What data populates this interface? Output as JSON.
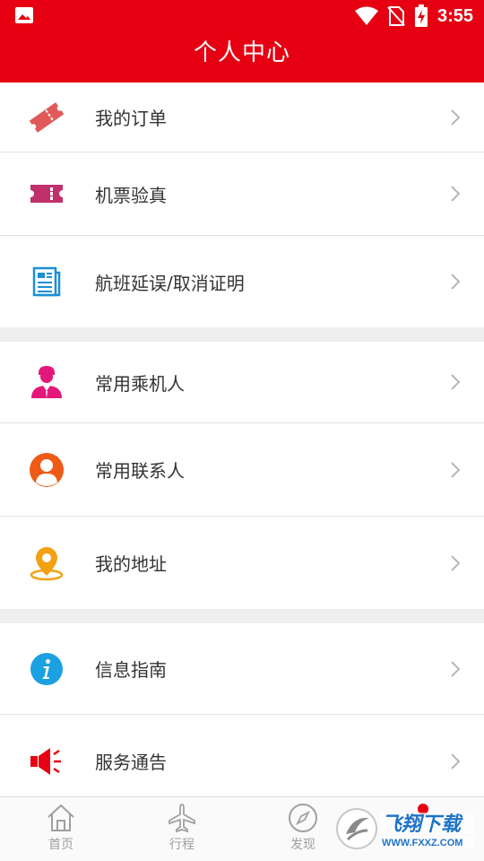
{
  "status_bar": {
    "time": "3:55"
  },
  "header": {
    "title": "个人中心"
  },
  "menu_groups": [
    {
      "items": [
        {
          "label": "我的订单",
          "icon": "ticket-icon",
          "color": "#e05a5a"
        },
        {
          "label": "机票验真",
          "icon": "boarding-pass-icon",
          "color": "#c0306c"
        },
        {
          "label": "航班延误/取消证明",
          "icon": "document-icon",
          "color": "#1a8fd6"
        }
      ]
    },
    {
      "items": [
        {
          "label": "常用乘机人",
          "icon": "passenger-icon",
          "color": "#e4187a"
        },
        {
          "label": "常用联系人",
          "icon": "contact-icon",
          "color": "#ef5a16"
        },
        {
          "label": "我的地址",
          "icon": "location-pin-icon",
          "color": "#f3a012"
        }
      ]
    },
    {
      "items": [
        {
          "label": "信息指南",
          "icon": "info-icon",
          "color": "#1ba0e2"
        },
        {
          "label": "服务通告",
          "icon": "megaphone-icon",
          "color": "#e60012"
        }
      ]
    }
  ],
  "bottom_nav": {
    "tabs": [
      {
        "label": "首页",
        "icon": "home-icon"
      },
      {
        "label": "行程",
        "icon": "plane-icon"
      },
      {
        "label": "发现",
        "icon": "compass-icon"
      }
    ]
  },
  "watermark": {
    "brand": "飞翔下载",
    "url": "WWW.FXXZ.COM"
  },
  "colors": {
    "brand_red": "#e60012",
    "nav_gray": "#a0a0a0"
  }
}
